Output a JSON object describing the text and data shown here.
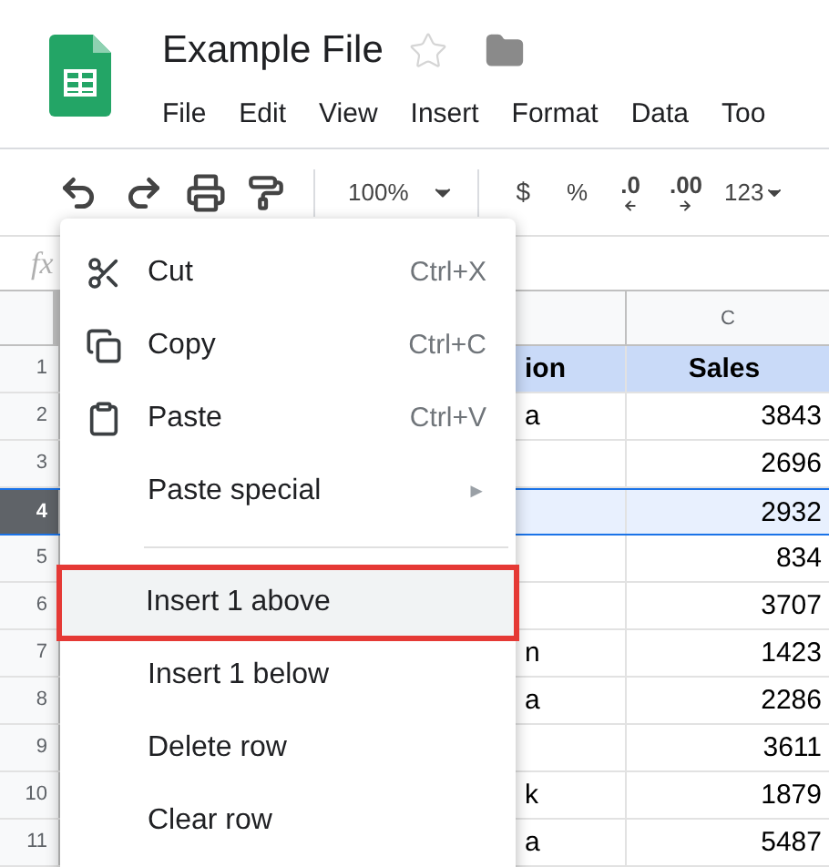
{
  "document": {
    "title": "Example File",
    "starred": false
  },
  "menu_bar": [
    "File",
    "Edit",
    "View",
    "Insert",
    "Format",
    "Data",
    "Too"
  ],
  "toolbar": {
    "zoom": "100%",
    "currency": "$",
    "percent": "%",
    "decrease_decimals": ".0",
    "increase_decimals": ".00",
    "more_formats": "123"
  },
  "formula_bar": {
    "label": "fx"
  },
  "columns": [
    {
      "header": "C"
    }
  ],
  "rows": [
    {
      "number": "1",
      "selected": false,
      "header_row": true,
      "cells": [
        "ion",
        "Sales"
      ]
    },
    {
      "number": "2",
      "selected": false,
      "header_row": false,
      "cells": [
        "a",
        "3843"
      ]
    },
    {
      "number": "3",
      "selected": false,
      "header_row": false,
      "cells": [
        "",
        "2696"
      ]
    },
    {
      "number": "4",
      "selected": true,
      "header_row": false,
      "cells": [
        "",
        "2932"
      ]
    },
    {
      "number": "5",
      "selected": false,
      "header_row": false,
      "cells": [
        "",
        "834"
      ]
    },
    {
      "number": "6",
      "selected": false,
      "header_row": false,
      "cells": [
        "",
        "3707"
      ]
    },
    {
      "number": "7",
      "selected": false,
      "header_row": false,
      "cells": [
        "n",
        "1423"
      ]
    },
    {
      "number": "8",
      "selected": false,
      "header_row": false,
      "cells": [
        "a",
        "2286"
      ]
    },
    {
      "number": "9",
      "selected": false,
      "header_row": false,
      "cells": [
        "",
        "3611"
      ]
    },
    {
      "number": "10",
      "selected": false,
      "header_row": false,
      "cells": [
        "k",
        "1879"
      ]
    },
    {
      "number": "11",
      "selected": false,
      "header_row": false,
      "cells": [
        "a",
        "5487"
      ]
    }
  ],
  "context_menu": [
    {
      "kind": "action",
      "label": "Cut",
      "shortcut": "Ctrl+X",
      "selected": false
    },
    {
      "kind": "action",
      "label": "Copy",
      "shortcut": "Ctrl+C",
      "selected": false
    },
    {
      "kind": "action",
      "label": "Paste",
      "shortcut": "Ctrl+V",
      "selected": false
    },
    {
      "kind": "submenu",
      "label": "Paste special",
      "arrow": "►",
      "selected": false
    },
    {
      "kind": "divider"
    },
    {
      "kind": "plain",
      "label": "Insert 1 above",
      "selected": true
    },
    {
      "kind": "plain",
      "label": "Insert 1 below",
      "selected": false
    },
    {
      "kind": "plain",
      "label": "Delete row",
      "selected": false
    },
    {
      "kind": "plain",
      "label": "Clear row",
      "selected": false
    }
  ]
}
